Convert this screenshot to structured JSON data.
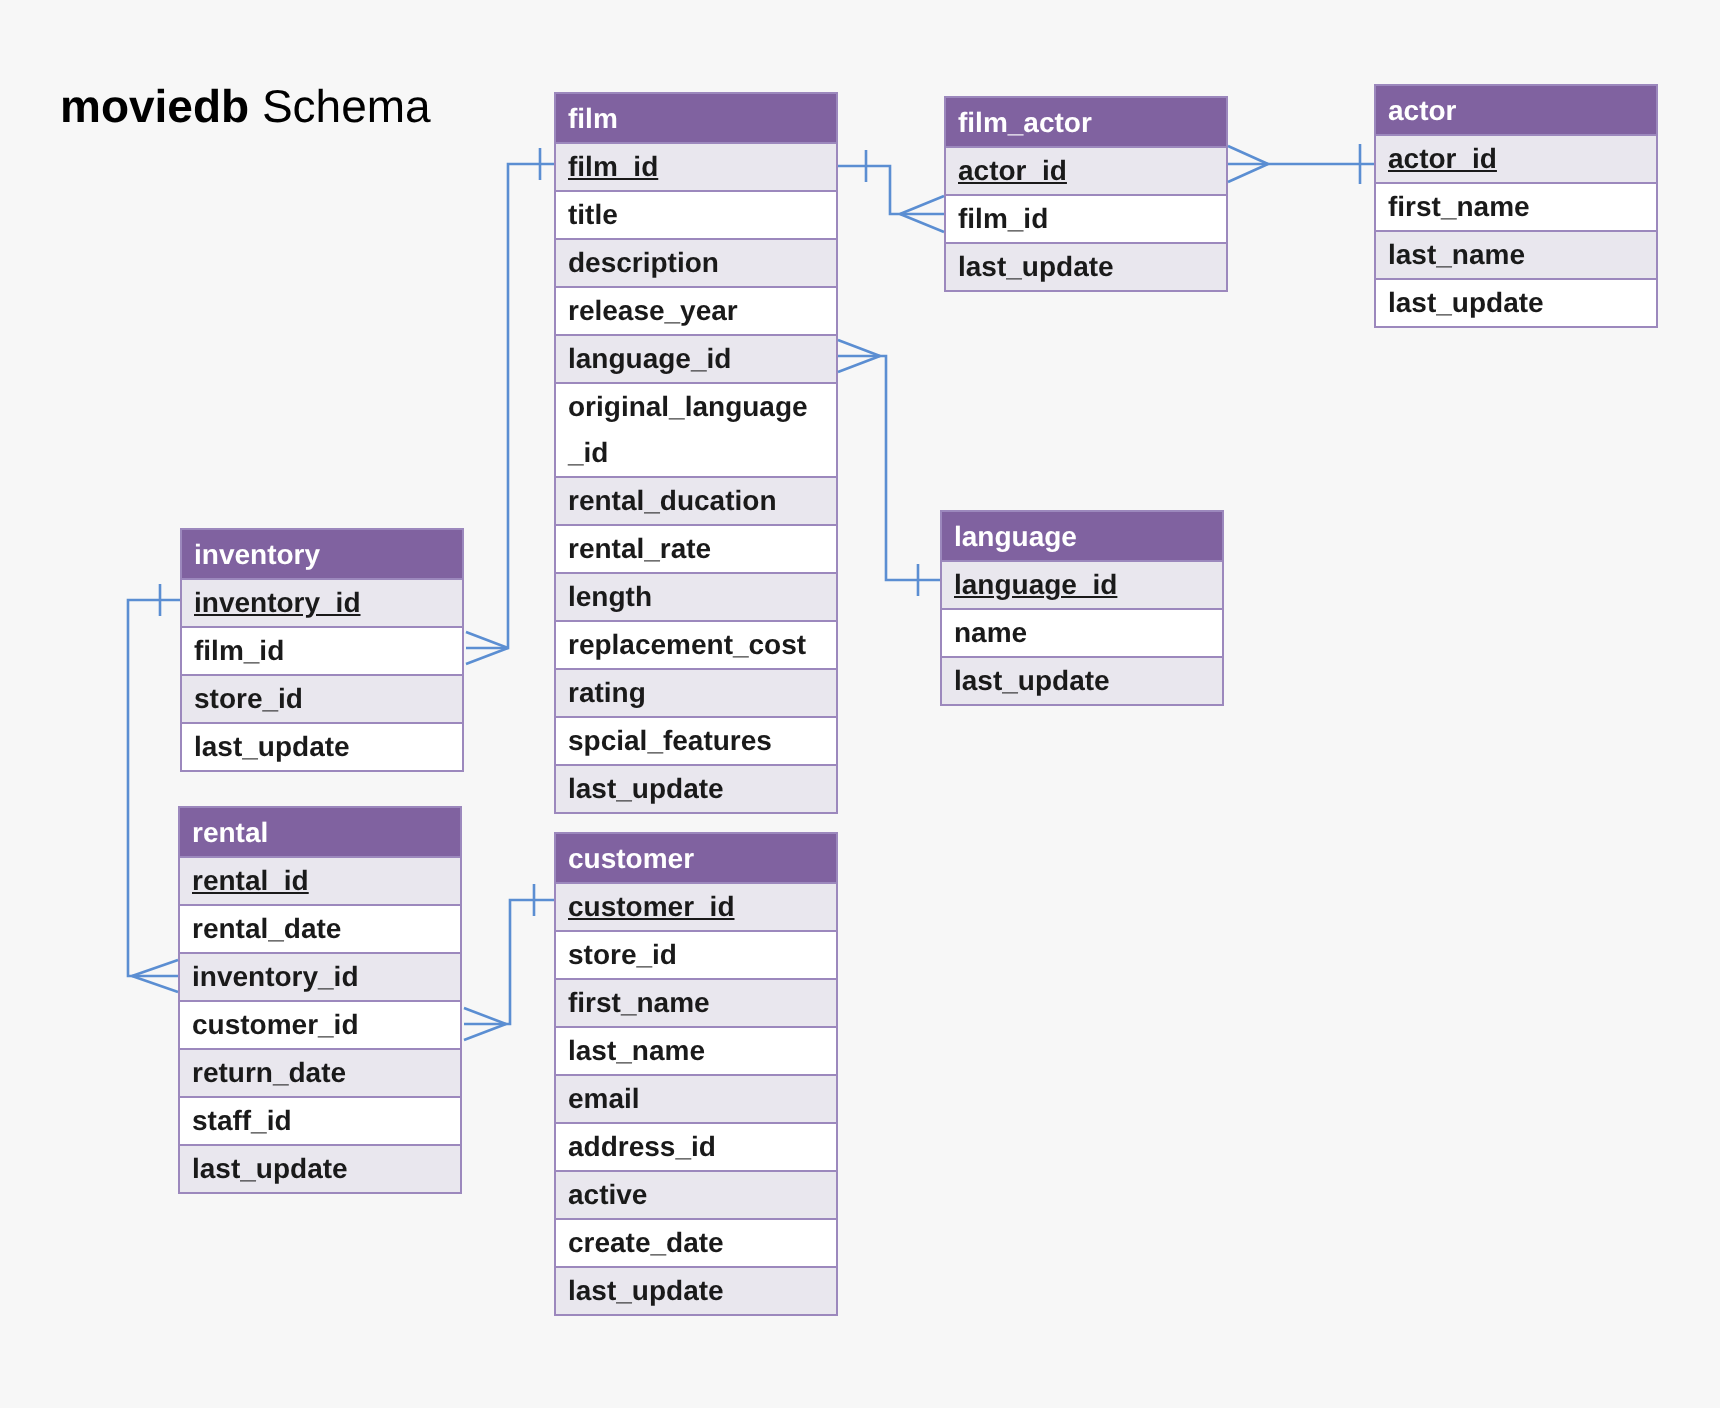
{
  "title": "**moviedb** Schema",
  "tables": [
    {
      "name": "film",
      "fields": [
        {
          "name": "film_id",
          "primary_key": true
        },
        {
          "name": "title",
          "primary_key": false
        },
        {
          "name": "description",
          "primary_key": false
        },
        {
          "name": "release_year",
          "primary_key": false
        },
        {
          "name": "language_id",
          "primary_key": false
        },
        {
          "name": "original_language _id",
          "primary_key": false
        },
        {
          "name": "rental_ducation",
          "primary_key": false
        },
        {
          "name": "rental_rate",
          "primary_key": false
        },
        {
          "name": "length",
          "primary_key": false
        },
        {
          "name": "replacement_cost",
          "primary_key": false
        },
        {
          "name": "rating",
          "primary_key": false
        },
        {
          "name": "spcial_features",
          "primary_key": false
        },
        {
          "name": "last_update",
          "primary_key": false
        }
      ]
    },
    {
      "name": "film_actor",
      "fields": [
        {
          "name": "actor_id",
          "primary_key": true
        },
        {
          "name": "film_id",
          "primary_key": false
        },
        {
          "name": "last_update",
          "primary_key": false
        }
      ]
    },
    {
      "name": "actor",
      "fields": [
        {
          "name": "actor_id",
          "primary_key": true
        },
        {
          "name": "first_name",
          "primary_key": false
        },
        {
          "name": "last_name",
          "primary_key": false
        },
        {
          "name": "last_update",
          "primary_key": false
        }
      ]
    },
    {
      "name": "language",
      "fields": [
        {
          "name": "language_id",
          "primary_key": true
        },
        {
          "name": "name",
          "primary_key": false
        },
        {
          "name": "last_update",
          "primary_key": false
        }
      ]
    },
    {
      "name": "inventory",
      "fields": [
        {
          "name": "inventory_id",
          "primary_key": true
        },
        {
          "name": "film_id",
          "primary_key": false
        },
        {
          "name": "store_id",
          "primary_key": false
        },
        {
          "name": "last_update",
          "primary_key": false
        }
      ]
    },
    {
      "name": "rental",
      "fields": [
        {
          "name": "rental_id",
          "primary_key": true
        },
        {
          "name": "rental_date",
          "primary_key": false
        },
        {
          "name": "inventory_id",
          "primary_key": false
        },
        {
          "name": "customer_id",
          "primary_key": false
        },
        {
          "name": "return_date",
          "primary_key": false
        },
        {
          "name": "staff_id",
          "primary_key": false
        },
        {
          "name": "last_update",
          "primary_key": false
        }
      ]
    },
    {
      "name": "customer",
      "fields": [
        {
          "name": "customer_id",
          "primary_key": true
        },
        {
          "name": "store_id",
          "primary_key": false
        },
        {
          "name": "first_name",
          "primary_key": false
        },
        {
          "name": "last_name",
          "primary_key": false
        },
        {
          "name": "email",
          "primary_key": false
        },
        {
          "name": "address_id",
          "primary_key": false
        },
        {
          "name": "active",
          "primary_key": false
        },
        {
          "name": "create_date",
          "primary_key": false
        },
        {
          "name": "last_update",
          "primary_key": false
        }
      ]
    }
  ]
}
